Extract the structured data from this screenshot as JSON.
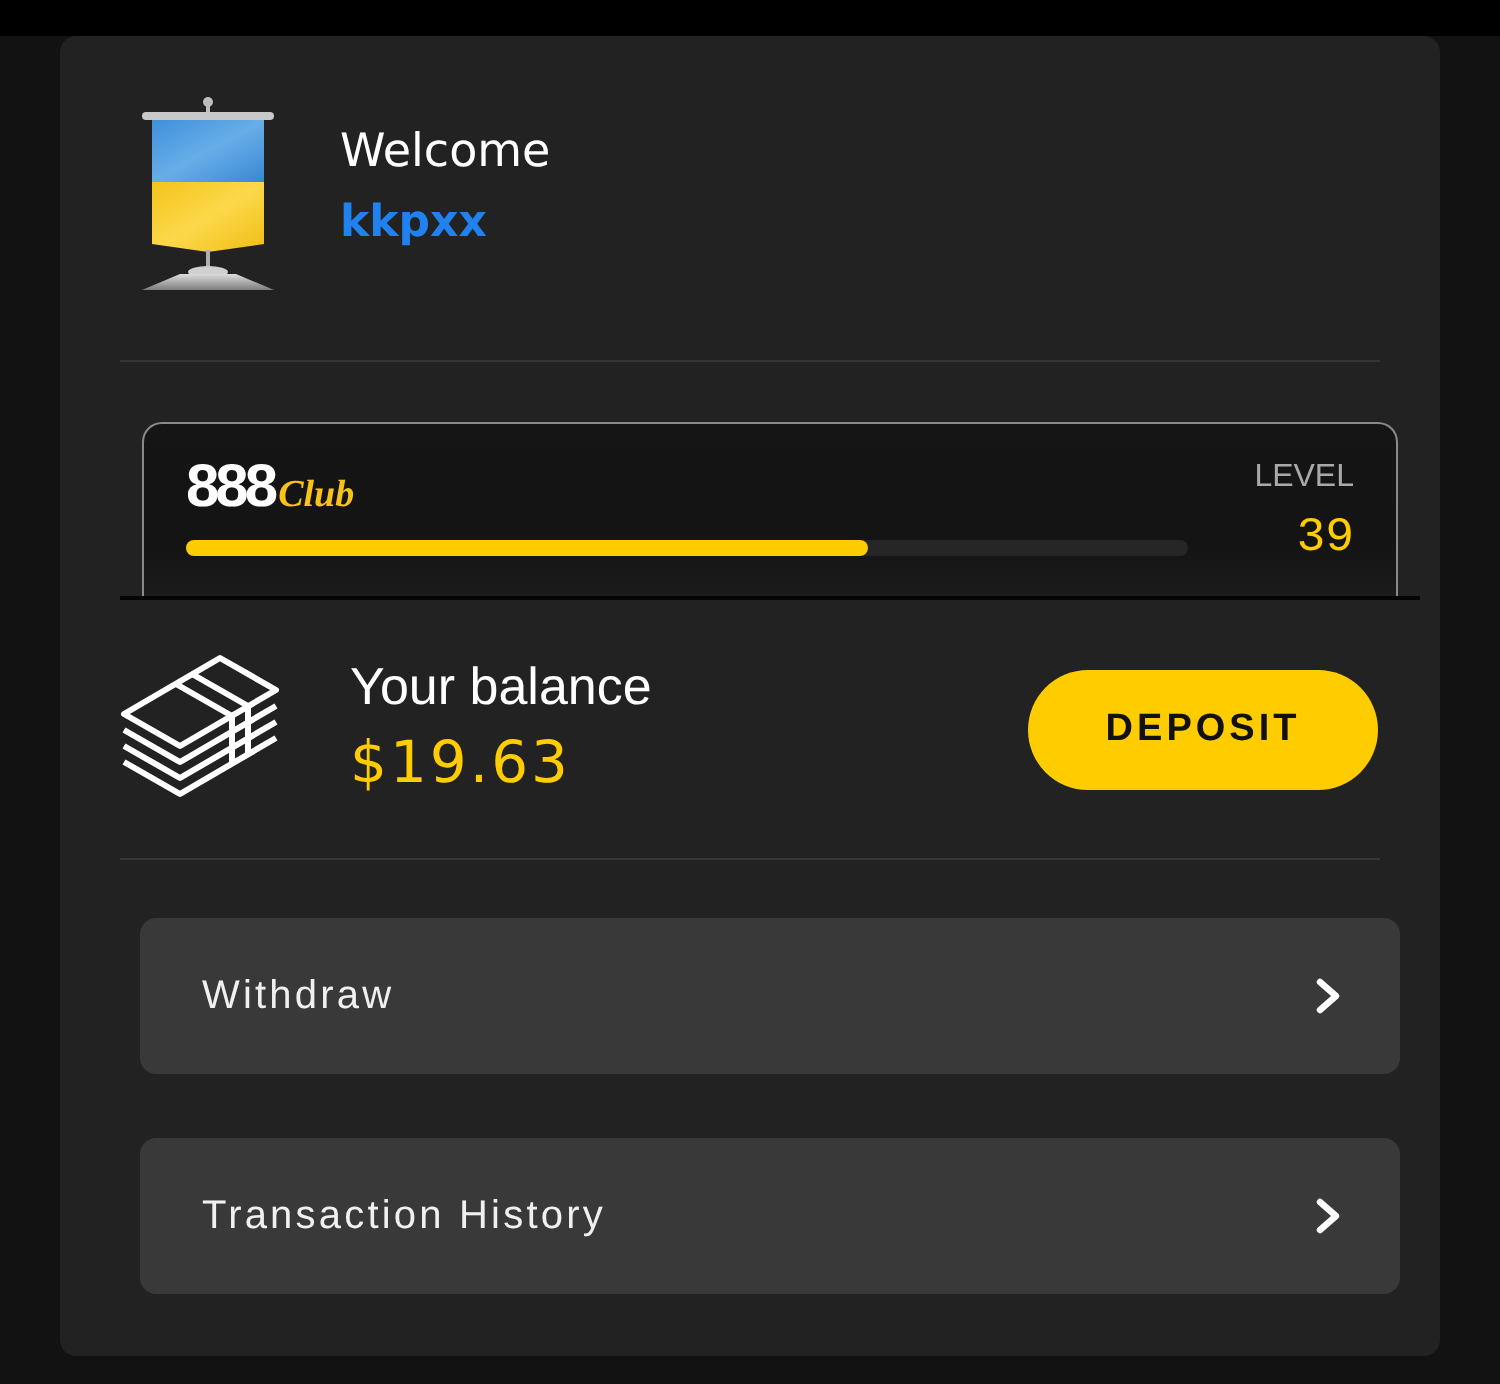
{
  "header": {
    "greeting": "Welcome",
    "username": "kkpxx"
  },
  "club": {
    "logo_number": "888",
    "logo_word": "Club",
    "level_label": "LEVEL",
    "level_value": "39",
    "level": 0.68
  },
  "balance": {
    "label": "Your balance",
    "amount": "$19.63",
    "deposit_button": "DEPOSIT"
  },
  "menu": [
    {
      "label": "Withdraw"
    },
    {
      "label": "Transaction History"
    }
  ]
}
